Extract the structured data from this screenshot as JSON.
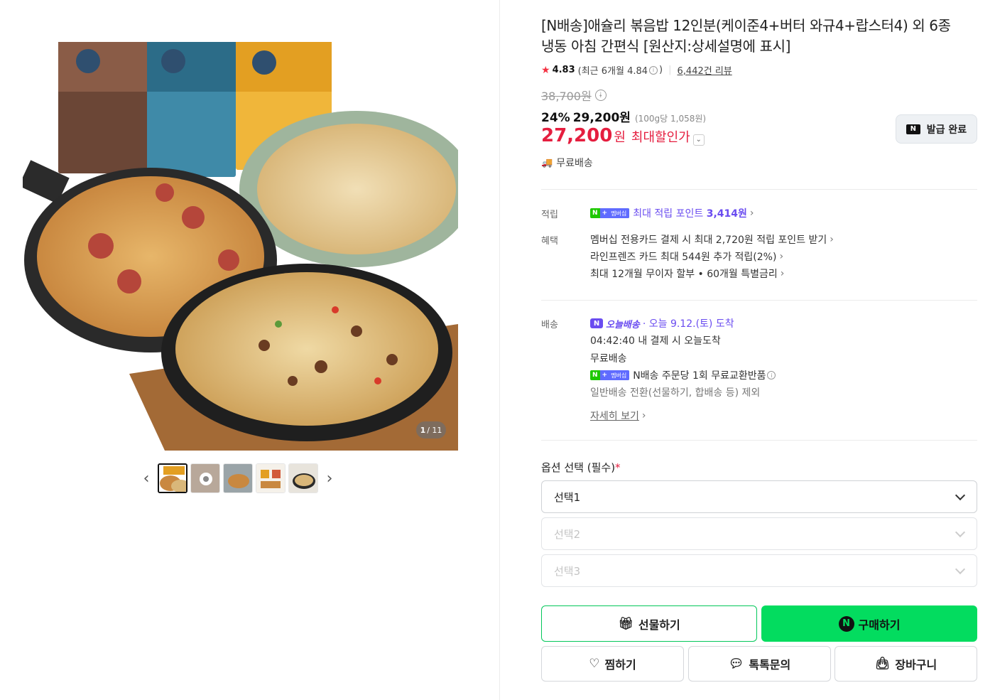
{
  "product": {
    "title_line1": "[N배송]애슐리 볶음밥 12인분(케이준4+버터 와규4+랍스터4) 외 6종",
    "title_line2": "냉동 아침 간편식 [원산지:상세설명에 표시]",
    "rating": "4.83",
    "recent_rating": "(최근 6개월 4.84",
    "recent_rating_close": ")",
    "review_count": "6,442건 리뷰",
    "original_price": "38,700원",
    "discount_pct": "24%",
    "discount_price": "29,200원",
    "unit_price": "(100g당 1,058원)",
    "max_price": "27,200",
    "max_price_won": "원",
    "max_price_label": "최대할인가",
    "coupon_label": "발급 완료",
    "free_shipping": "무료배송"
  },
  "gallery": {
    "counter_current": "1",
    "counter_total": "/ 11",
    "thumb_count": 5
  },
  "points": {
    "label": "적립",
    "text": "최대 적립 포인트 ",
    "amount": "3,414원"
  },
  "benefits": {
    "label": "혜택",
    "items": [
      "멤버십 전용카드 결제 시 최대 2,720원 적립 포인트 받기",
      "라인프렌즈 카드 최대 544원 추가 적립(2%)",
      "최대 12개월 무이자 할부 • 60개월 특별금리"
    ]
  },
  "delivery": {
    "label": "배송",
    "today_badge": "오늘배송",
    "arrival": "· 오늘 9.12.(토) 도착",
    "deadline": "04:42:40  내 결제 시 오늘도착",
    "free": "무료배송",
    "exchange": "N배송 주문당 1회 무료교환반품",
    "note": "일반배송 전환(선물하기, 합배송 등) 제외",
    "more": "자세히 보기"
  },
  "badge": {
    "n": "N",
    "plus": "+",
    "membership": "멤버십"
  },
  "options": {
    "title": "옵션 선택 (필수)",
    "required_mark": "*",
    "select1": "선택1",
    "select2": "선택2",
    "select3": "선택3"
  },
  "buttons": {
    "gift": "선물하기",
    "buy": "구매하기",
    "wish": "찜하기",
    "talk": "톡톡문의",
    "cart": "장바구니"
  },
  "colors": {
    "accent_green": "#03dc5f",
    "price_red": "#e51e3f",
    "membership_purple": "#6a4cf0"
  }
}
